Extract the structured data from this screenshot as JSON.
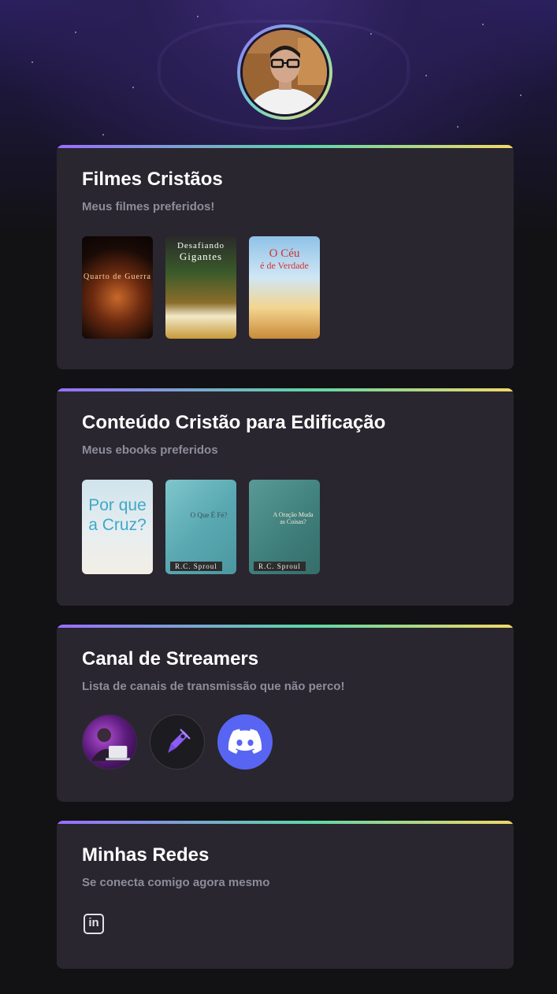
{
  "cards": [
    {
      "title": "Filmes Cristãos",
      "subtitle": "Meus filmes preferidos!",
      "items": [
        {
          "icon": "movie-poster",
          "title": "Quarto de Guerra"
        },
        {
          "icon": "movie-poster",
          "title_line1": "Desafiando",
          "title_line2": "Gigantes"
        },
        {
          "icon": "movie-poster",
          "title_line1": "O Céu",
          "title_line2": "é de Verdade"
        }
      ]
    },
    {
      "title": "Conteúdo Cristão para Edificação",
      "subtitle": "Meus ebooks preferidos",
      "items": [
        {
          "icon": "ebook-cover",
          "title": "Por que a Cruz?"
        },
        {
          "icon": "ebook-cover",
          "title": "O Que É Fé?",
          "author": "R.C. Sproul"
        },
        {
          "icon": "ebook-cover",
          "title": "A Oração Muda as Coisas?",
          "author": "R.C. Sproul"
        }
      ]
    },
    {
      "title": "Canal de Streamers",
      "subtitle": "Lista de canais de transmissão que não perco!",
      "items": [
        {
          "icon": "streamer-avatar-icon"
        },
        {
          "icon": "rocket-pen-icon"
        },
        {
          "icon": "discord-icon"
        }
      ]
    },
    {
      "title": "Minhas Redes",
      "subtitle": "Se conecta comigo agora mesmo",
      "items": [
        {
          "icon": "linkedin-icon",
          "label": "in"
        }
      ]
    }
  ],
  "colors": {
    "background": "#121214",
    "card": "#29262f",
    "accent_gradient": [
      "#996dff",
      "#5fd6a8",
      "#f2d869"
    ],
    "discord": "#5865f2"
  }
}
